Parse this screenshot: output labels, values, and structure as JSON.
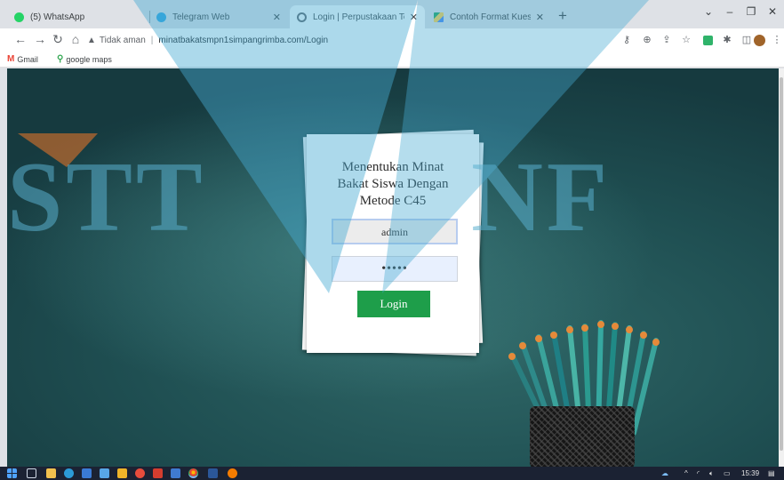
{
  "browser": {
    "tabs": [
      {
        "title": "(5) WhatsApp",
        "favicon_color": "#25d366"
      },
      {
        "title": "Telegram Web",
        "favicon_color": "#2aa3e0"
      },
      {
        "title": "Login | Perpustakaan Teknik",
        "favicon_color": "#5f6368",
        "active": true
      },
      {
        "title": "Contoh Format Kuesioner Angke",
        "favicon_color": "#1fa463"
      }
    ],
    "new_tab": "+",
    "window_controls": {
      "dropdown": "⌄",
      "minimize": "–",
      "restore": "❐",
      "close": "✕"
    }
  },
  "toolbar": {
    "security_label": "Tidak aman",
    "url": "minatbakatsmpn1simpangrimba.com/Login",
    "icons": [
      "key-icon",
      "install-icon",
      "share-icon",
      "star-icon",
      "extension-icon",
      "puzzle-icon",
      "sidepanel-icon",
      "profile-icon",
      "menu-icon"
    ]
  },
  "bookmarks": [
    {
      "label": "Gmail",
      "icon": "gmail-icon",
      "color": "#ea4335"
    },
    {
      "label": "google maps",
      "icon": "maps-icon",
      "color": "#34a853"
    }
  ],
  "login": {
    "title_lines": [
      "Menentukan Minat",
      "Bakat Siswa Dengan",
      "Metode C45"
    ],
    "username_value": "admin",
    "password_value": "•••••",
    "button_label": "Login"
  },
  "watermark": {
    "text_left": "STT",
    "text_right": "NF"
  },
  "taskbar": {
    "time": "15:39",
    "accent": "#1b2233"
  }
}
